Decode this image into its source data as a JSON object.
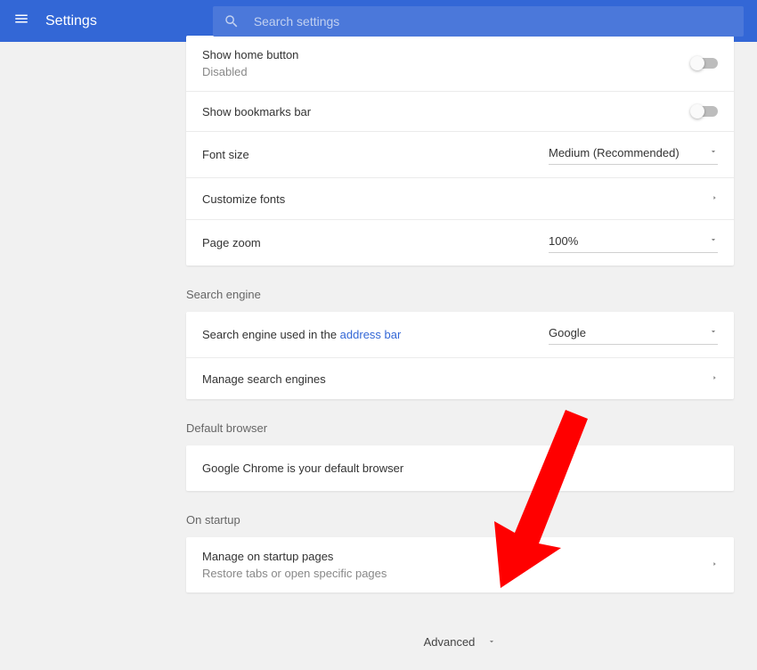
{
  "header": {
    "title": "Settings",
    "search_placeholder": "Search settings"
  },
  "appearance": {
    "show_home": {
      "label": "Show home button",
      "sub": "Disabled"
    },
    "show_bookmarks": {
      "label": "Show bookmarks bar"
    },
    "font_size": {
      "label": "Font size",
      "value": "Medium (Recommended)"
    },
    "customize_fonts": {
      "label": "Customize fonts"
    },
    "page_zoom": {
      "label": "Page zoom",
      "value": "100%"
    }
  },
  "search_section": {
    "heading": "Search engine",
    "used_in_pre": "Search engine used in the ",
    "used_in_link": "address bar",
    "value": "Google",
    "manage": "Manage search engines"
  },
  "default_browser": {
    "heading": "Default browser",
    "text": "Google Chrome is your default browser"
  },
  "startup": {
    "heading": "On startup",
    "manage": "Manage on startup pages",
    "sub": "Restore tabs or open specific pages"
  },
  "advanced": {
    "label": "Advanced"
  }
}
